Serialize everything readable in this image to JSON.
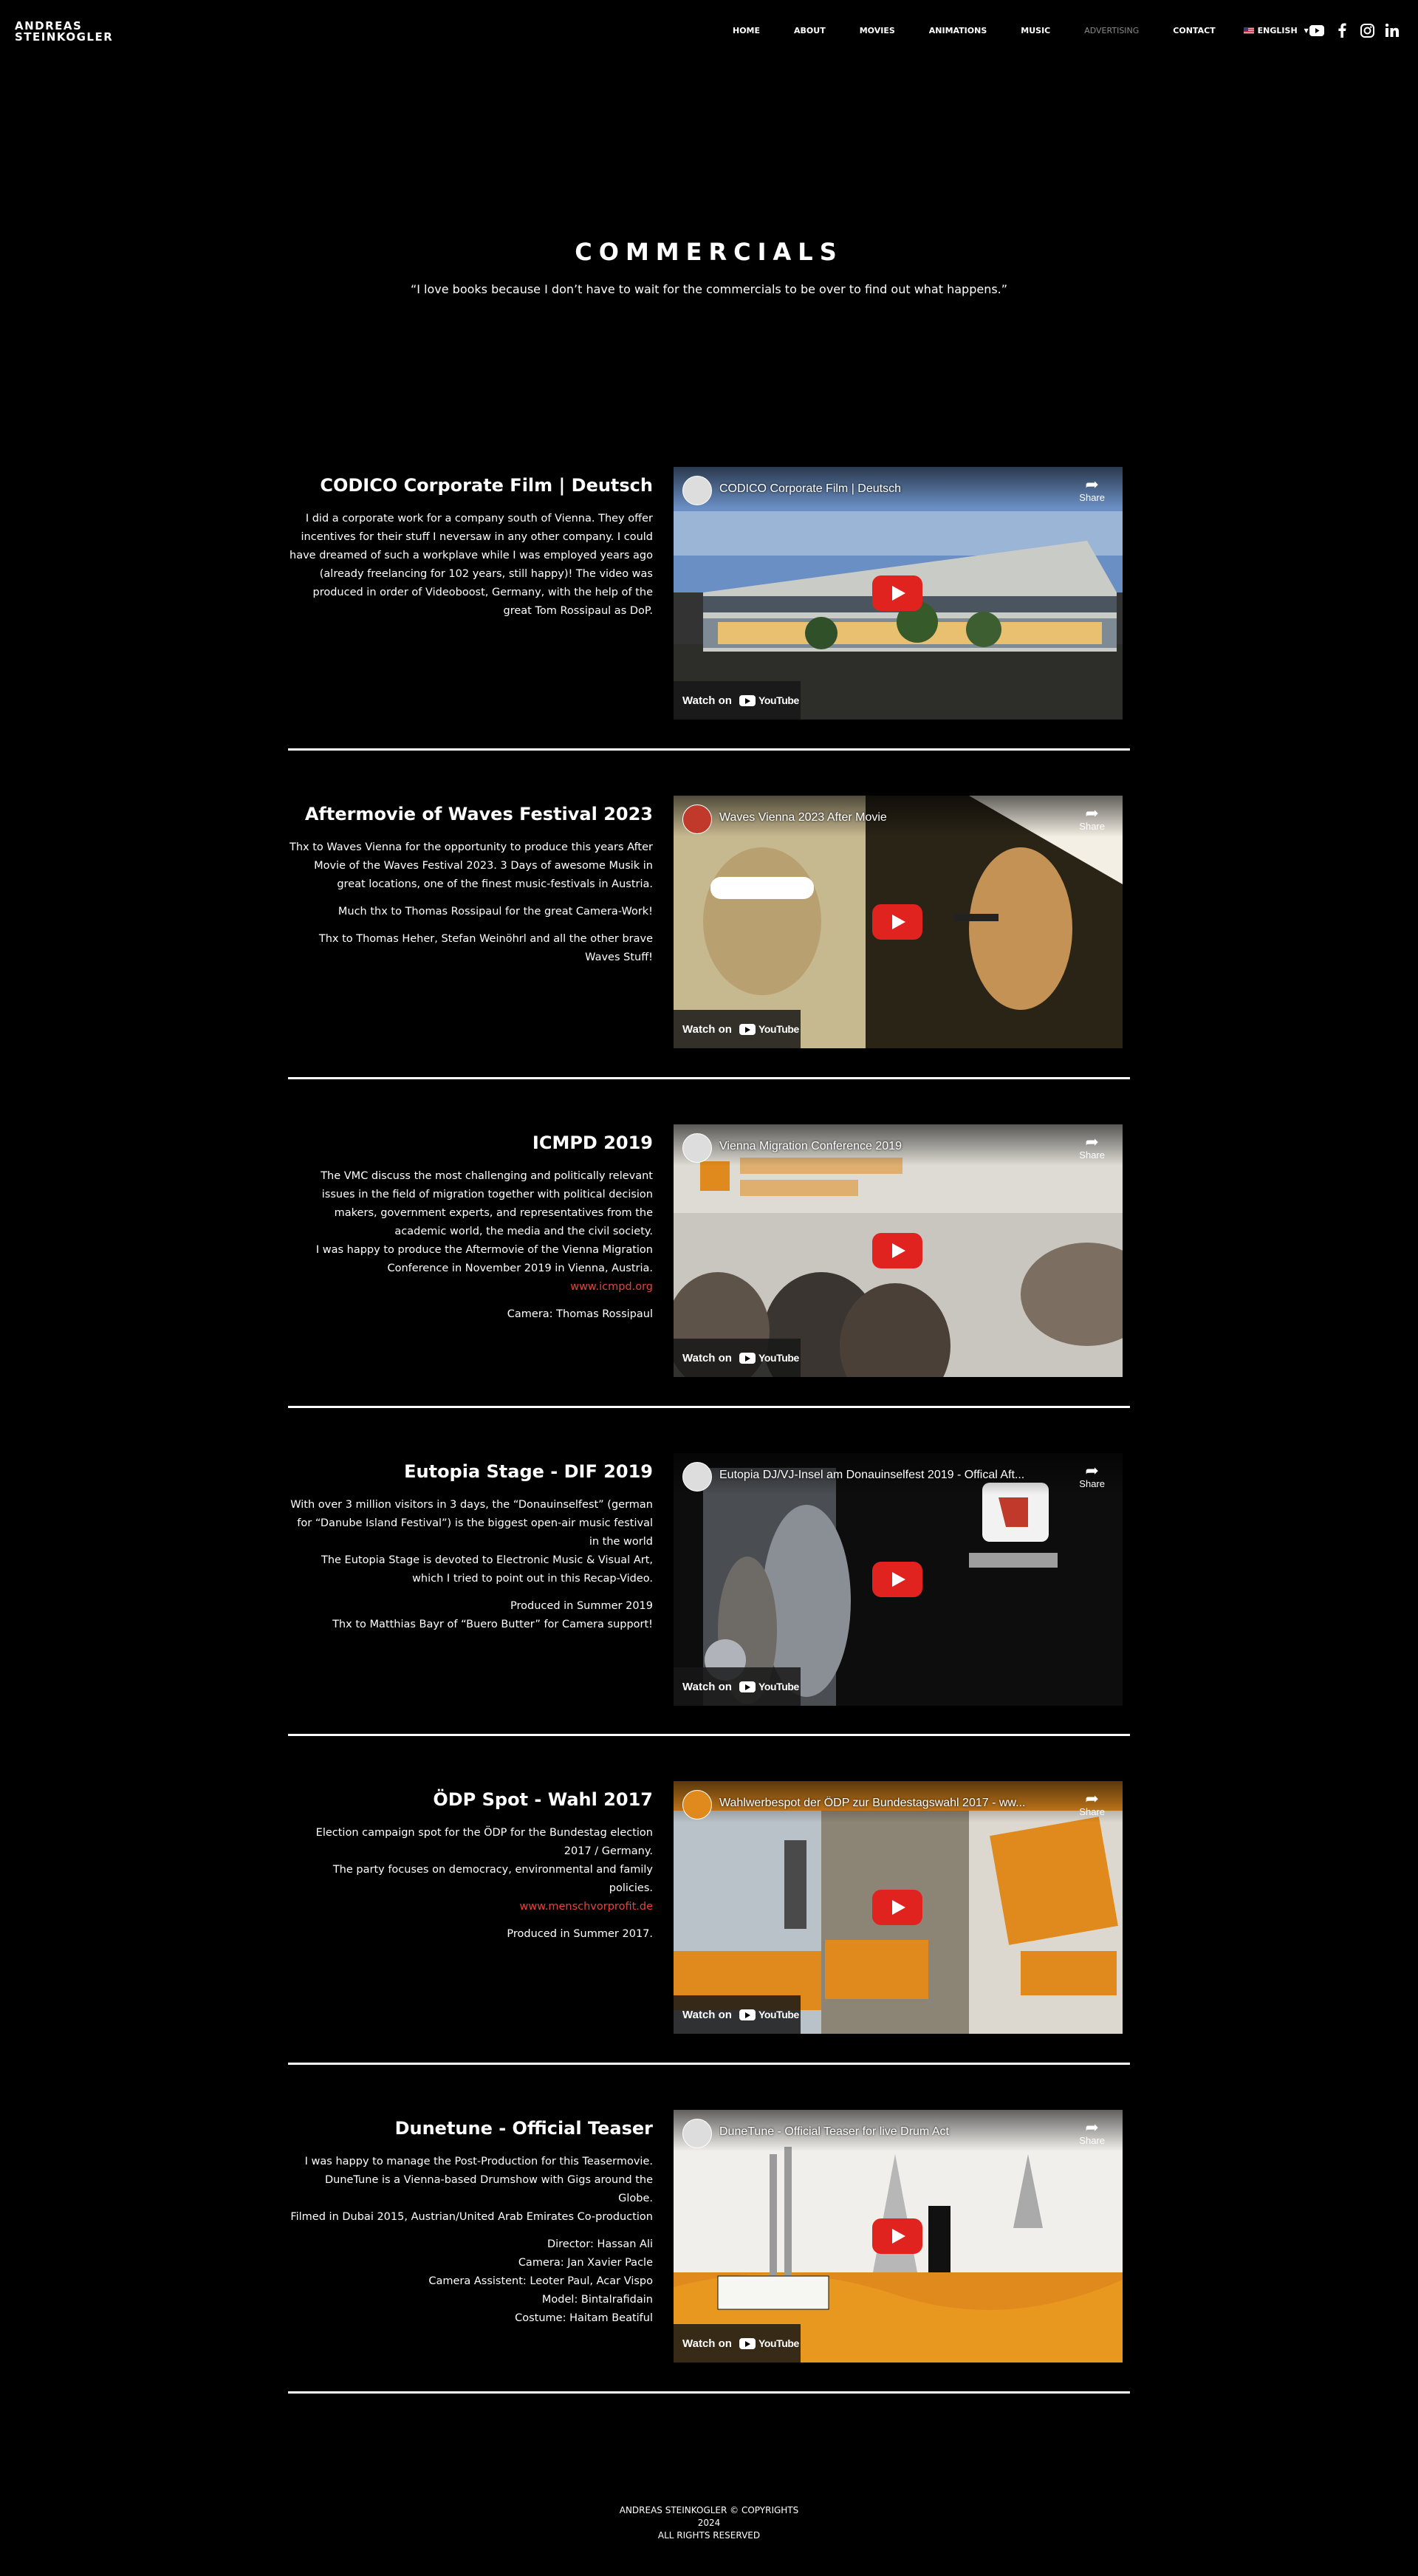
{
  "header": {
    "logo_line1": "ANDREAS",
    "logo_line2": "STEINKOGLER",
    "nav": [
      {
        "label": "HOME"
      },
      {
        "label": "ABOUT"
      },
      {
        "label": "MOVIES"
      },
      {
        "label": "ANIMATIONS"
      },
      {
        "label": "MUSIC"
      },
      {
        "label": "ADVERTISING"
      },
      {
        "label": "CONTACT"
      }
    ],
    "language": "ENGLISH",
    "social_icons": [
      "youtube-icon",
      "facebook-icon",
      "instagram-icon",
      "linkedin-icon"
    ]
  },
  "hero": {
    "title": "COMMERCIALS",
    "quote": "“I love books because I don’t have to wait for the commercials to be over to find out what happens.”"
  },
  "sections": [
    {
      "title": "CODICO Corporate Film | Deutsch",
      "paragraphs": [
        "I did a corporate work for a company south of Vienna. They offer incentives for their stuff I neversaw in any other company. I could have dreamed of such a workplave while I was employed years ago (already freelancing for 102 years, still happy)! The video was produced in order of Videoboost, Germany, with the help of the great Tom Rossipaul as DoP."
      ],
      "video_title": "CODICO Corporate Film | Deutsch"
    },
    {
      "title": "Aftermovie of Waves Festival 2023",
      "paragraphs": [
        "Thx to Waves Vienna for the opportunity to produce this years After Movie of the Waves Festival 2023. 3 Days of awesome Musik in great locations, one of the finest music-festivals in Austria.",
        "Much thx to Thomas Rossipaul for the great Camera-Work!",
        "Thx to Thomas Heher, Stefan Weinöhrl and all the other brave Waves Stuff!"
      ],
      "video_title": "Waves Vienna 2023 After Movie"
    },
    {
      "title": "ICMPD 2019",
      "paragraphs": [
        "The VMC discuss the most challenging and politically relevant issues in the field of migration together with political decision makers, government experts, and representatives from the academic world, the media and the civil society.",
        "I was happy to produce the Aftermovie of the Vienna Migration Conference in November 2019 in Vienna, Austria."
      ],
      "link": "www.icmpd.org",
      "after_link": "Camera: Thomas Rossipaul",
      "video_title": "Vienna Migration Conference 2019"
    },
    {
      "title": "Eutopia Stage - DIF 2019",
      "paragraphs": [
        "With over 3 million visitors in 3 days, the “Donauinselfest” (german for “Danube Island Festival”) is the biggest open-air music festival in the world",
        "The Eutopia Stage is devoted to Electronic Music & Visual Art, which I tried to point out in this Recap-Video.",
        "Produced in Summer 2019",
        "Thx to Matthias Bayr of “Buero Butter” for Camera support!"
      ],
      "video_title": "Eutopia DJ/VJ-Insel am Donauinselfest 2019 - Offical Aft..."
    },
    {
      "title": "ÖDP Spot - Wahl 2017",
      "paragraphs": [
        "Election campaign spot for the ÖDP for the Bundestag election 2017 / Germany.",
        "The party focuses on democracy, environmental and family policies."
      ],
      "link": "www.menschvorprofit.de",
      "after_link": "Produced in Summer 2017.",
      "video_title": "Wahlwerbespot der ÖDP zur Bundestagswahl 2017 - ww..."
    },
    {
      "title": "Dunetune - Official Teaser",
      "paragraphs": [
        "I was happy to manage the Post-Production for this Teasermovie. DuneTune is a Vienna-based Drumshow with Gigs around the Globe.",
        "Filmed in Dubai 2015, Austrian/United Arab Emirates Co-production",
        "Director: Hassan Ali",
        "Camera: Jan Xavier Pacle",
        "Camera Assistent: Leoter Paul, Acar Vispo",
        "Model: Bintalrafidain",
        "Costume: Haitam Beatiful"
      ],
      "video_title": "DuneTune - Official Teaser for live Drum Act"
    }
  ],
  "video_ui": {
    "share": "Share",
    "watch_on": "Watch on",
    "youtube": "YouTube"
  },
  "footer": {
    "line1": "ANDREAS STEINKOGLER © COPYRIGHTS",
    "line2": "2024",
    "line3": "ALL RIGHTS RESERVED"
  },
  "colors": {
    "background": "#000000",
    "text": "#ffffff",
    "link": "#e2453c",
    "play_button": "#e1231f"
  }
}
